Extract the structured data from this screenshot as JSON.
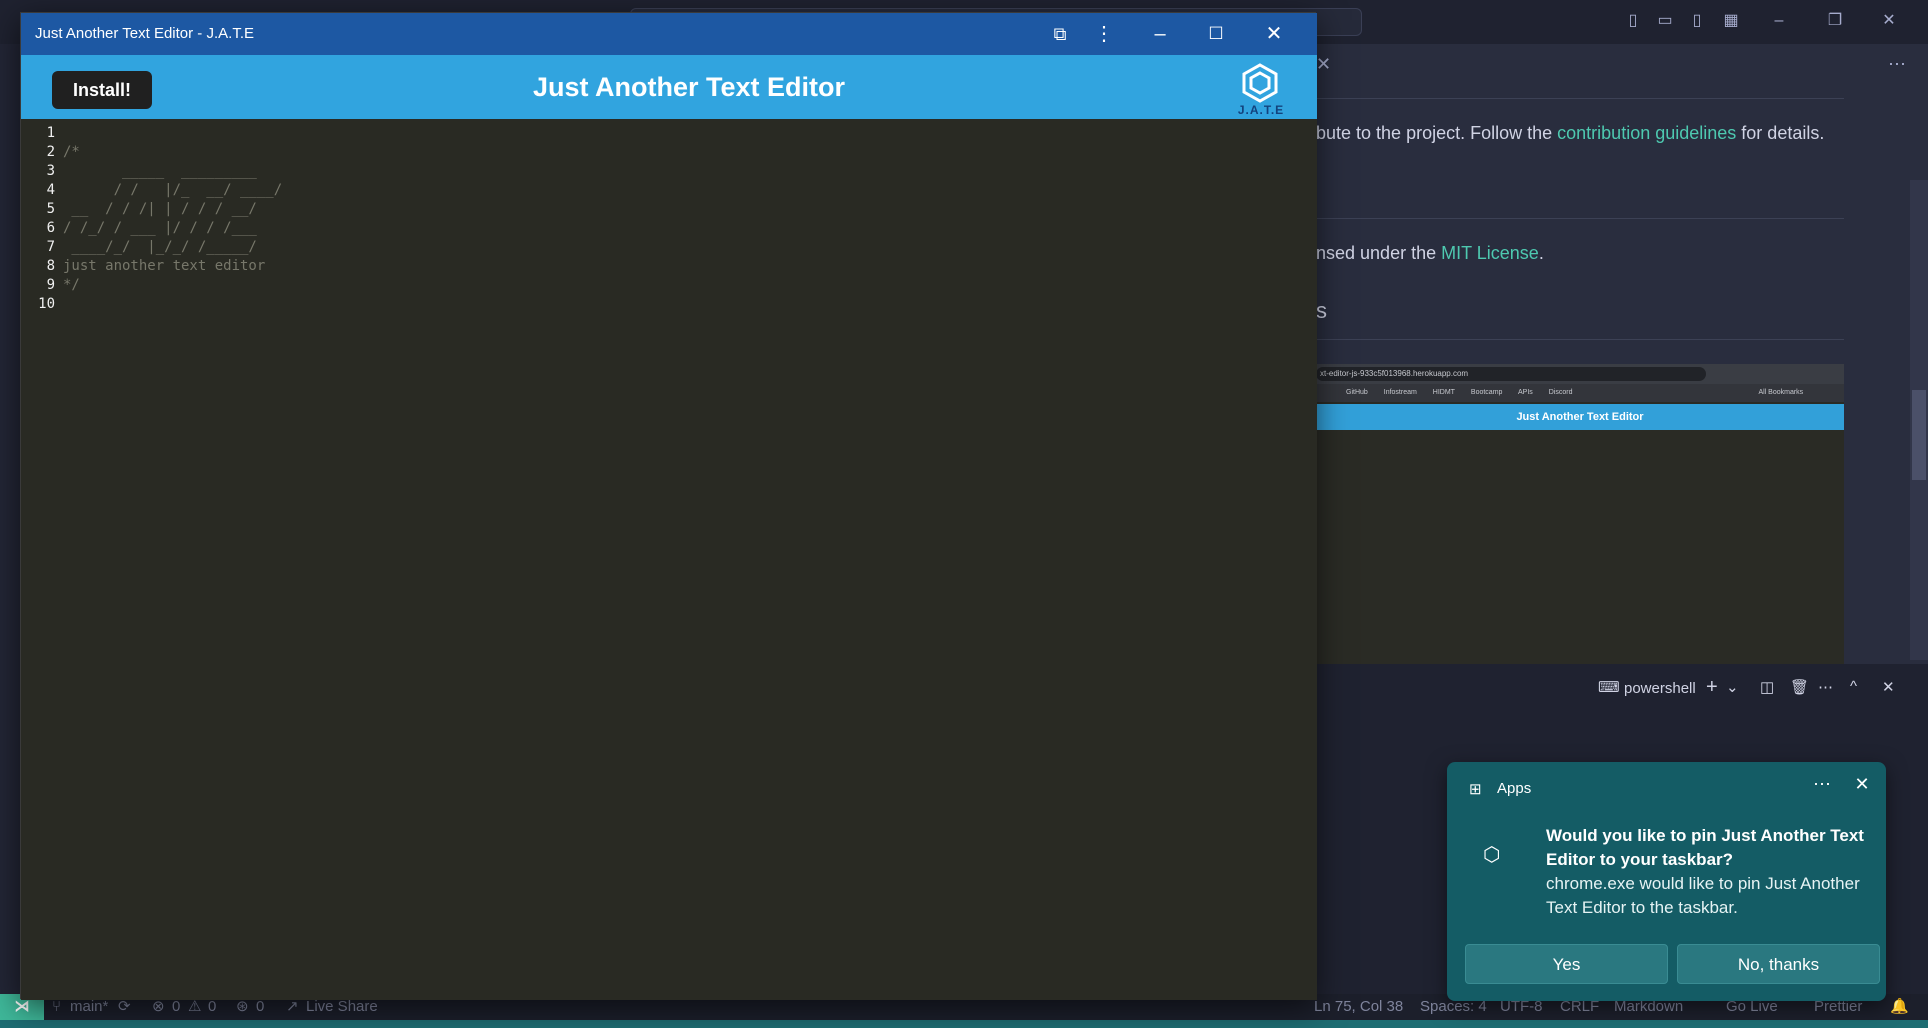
{
  "vscode": {
    "readme_text1_prefix": "bute to the project. Follow the",
    "readme_link1": "contribution guidelines",
    "readme_text1_suffix": "for details.",
    "readme_text2_prefix": "nsed under the",
    "readme_link2": "MIT License",
    "readme_text2_suffix": ".",
    "readme_heading_fragment": "s",
    "screenshot": {
      "url": "xt-editor-js-933c5f013968.herokuapp.com",
      "bookmarks": [
        "GitHub",
        "Infostream",
        "HIDMT",
        "Bootcamp",
        "APIs",
        "Discord",
        "All Bookmarks"
      ],
      "header": "Just Another Text Editor"
    },
    "terminal": {
      "shell": "powershell"
    },
    "status": {
      "branch": "main*",
      "errors": "0",
      "warnings": "0",
      "ports": "0",
      "live_share": "Live Share",
      "position": "Ln 75, Col 38",
      "spaces": "Spaces: 4",
      "encoding": "UTF-8",
      "eol": "CRLF",
      "language": "Markdown",
      "go_live": "Go Live",
      "prettier": "Prettier"
    }
  },
  "jate": {
    "window_title": "Just Another Text Editor - J.A.T.E",
    "install_label": "Install!",
    "app_title": "Just Another Text Editor",
    "logo_text": "J.A.T.E",
    "lines": [
      {
        "n": "1",
        "text": ""
      },
      {
        "n": "2",
        "text": "/*"
      },
      {
        "n": "3",
        "text": "       _____  _________"
      },
      {
        "n": "4",
        "text": "      / /   |/_  __/ ____/"
      },
      {
        "n": "5",
        "text": " __  / / /| | / / / __/"
      },
      {
        "n": "6",
        "text": "/ /_/ / ___ |/ / / /___"
      },
      {
        "n": "7",
        "text": " ____/_/  |_/_/ /_____/"
      },
      {
        "n": "8",
        "text": "just another text editor"
      },
      {
        "n": "9",
        "text": "*/"
      },
      {
        "n": "10",
        "text": ""
      }
    ]
  },
  "toast": {
    "source": "Apps",
    "message": "Would you like to pin Just Another Text Editor to your taskbar?",
    "detail": "chrome.exe would like to pin Just Another Text Editor to the taskbar.",
    "yes_label": "Yes",
    "no_label": "No, thanks"
  }
}
